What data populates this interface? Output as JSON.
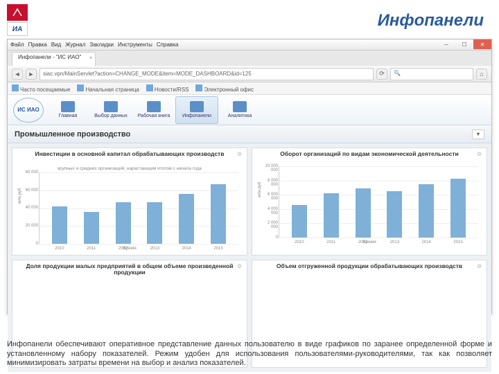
{
  "slide": {
    "title": "Инфопанели"
  },
  "browser": {
    "menu": [
      "Файл",
      "Правка",
      "Вид",
      "Журнал",
      "Закладки",
      "Инструменты",
      "Справка"
    ],
    "tab": {
      "label": "Инфопанели - \"ИС ИАО\""
    },
    "url": "siac.vpn/MainServlet?action=CHANGE_MODE&item=MODE_DASHBOARD&id=125",
    "search_placeholder": "Поиск",
    "bookmarks": [
      "Часто посещаемые",
      "Начальная страница",
      "Новости/RSS",
      "Электронный офис"
    ]
  },
  "appnav": {
    "logo": "ИС ИАО",
    "items": [
      {
        "label": "Главная"
      },
      {
        "label": "Выбор данных"
      },
      {
        "label": "Рабочая книга"
      },
      {
        "label": "Инфопанели",
        "active": true
      },
      {
        "label": "Аналитика"
      }
    ]
  },
  "section": {
    "title": "Промышленное производство"
  },
  "chart_data": [
    {
      "type": "bar",
      "title": "Инвестиции в основной капитал обрабатывающих производств",
      "subtitle": "крупных и средних организаций, нарастающим итогом с начала года",
      "xlabel": "Время",
      "ylabel": "млн.руб",
      "ylim": [
        0,
        80000
      ],
      "yticks": [
        0,
        20000,
        40000,
        60000,
        80000
      ],
      "categories": [
        "2010",
        "2011",
        "2012",
        "2013",
        "2014",
        "2015"
      ],
      "values": [
        42000,
        36000,
        47000,
        47000,
        56000,
        67000
      ]
    },
    {
      "type": "bar",
      "title": "Оборот организаций по видам экономической деятельности",
      "subtitle": "",
      "xlabel": "Время",
      "ylabel": "млн.руб",
      "ylim": [
        0,
        10000000
      ],
      "yticks": [
        0,
        2000000,
        4000000,
        6000000,
        8000000,
        10000000
      ],
      "categories": [
        "2010",
        "2011",
        "2012",
        "2013",
        "2014",
        "2015"
      ],
      "values": [
        4600000,
        6200000,
        6900000,
        6500000,
        7500000,
        8300000
      ]
    },
    {
      "type": "bar",
      "title": "Доля продукции малых предприятий в общем объеме произведенной продукции",
      "subtitle": "",
      "xlabel": "",
      "ylabel": "",
      "ylim": [
        0,
        100
      ],
      "yticks": [],
      "categories": [],
      "values": []
    },
    {
      "type": "bar",
      "title": "Объем отгруженной продукции обрабатывающих производств",
      "subtitle": "",
      "xlabel": "",
      "ylabel": "",
      "ylim": [
        0,
        100
      ],
      "yticks": [],
      "categories": [],
      "values": []
    }
  ],
  "description": "Инфопанели обеспечивают оперативное представление данных пользователю в виде графиков по заранее определенной форме и установленному набору показателей. Режим удобен для использования пользователями-руководителями, так как позволяет минимизировать затраты времени на выбор и анализ показателей."
}
